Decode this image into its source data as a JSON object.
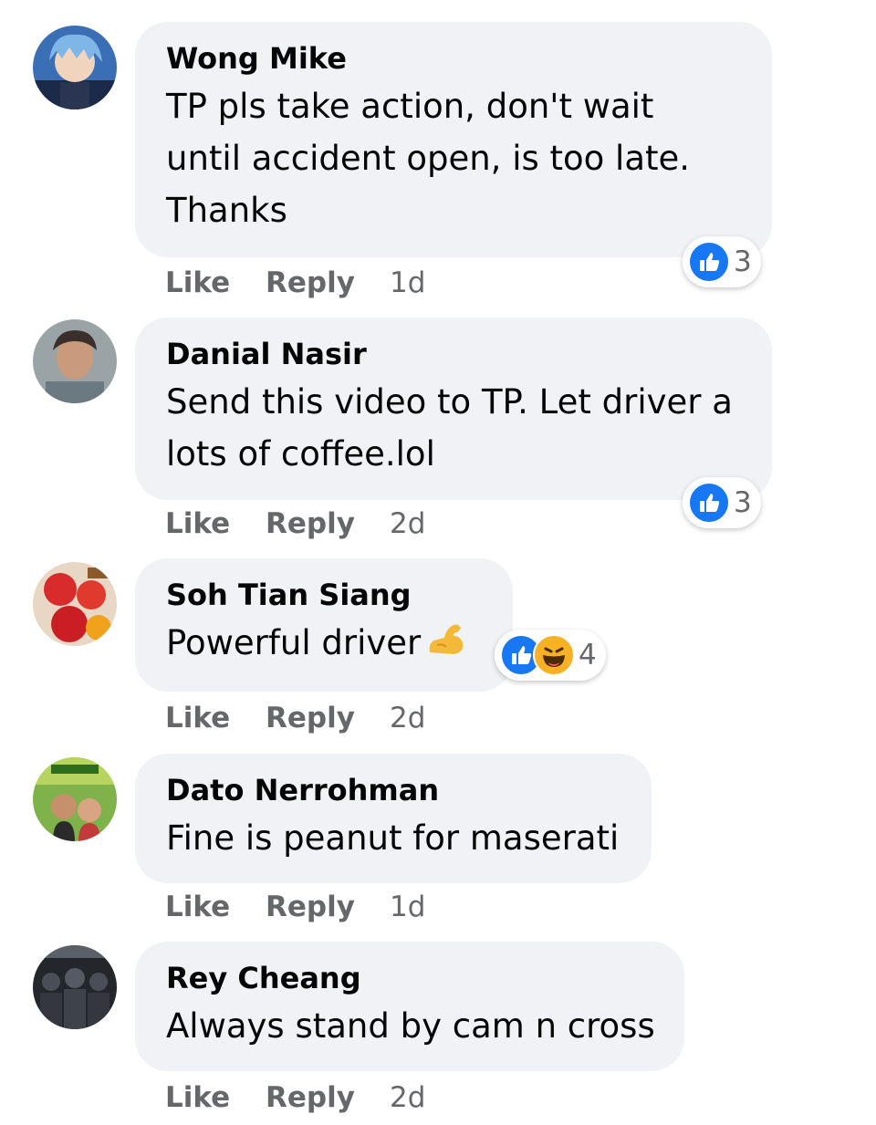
{
  "actions": {
    "like_label": "Like",
    "reply_label": "Reply"
  },
  "colors": {
    "bubble_bg": "#f0f2f5",
    "meta_text": "#65676b",
    "like_blue": "#1877f2",
    "haha_yellow": "#f7b125"
  },
  "comments": [
    {
      "author": "Wong Mike",
      "text_lines": [
        "TP pls take action, don't wait",
        "until accident open, is too late.",
        "Thanks"
      ],
      "time": "1d",
      "reactions": [
        "like-icon"
      ],
      "reaction_count": "3"
    },
    {
      "author": "Danial Nasir",
      "text_lines": [
        "Send this video to TP. Let driver a",
        "lots of coffee.lol"
      ],
      "time": "2d",
      "reactions": [
        "like-icon"
      ],
      "reaction_count": "3"
    },
    {
      "author": "Soh Tian Siang",
      "text_lines": [
        "Powerful driver"
      ],
      "emoji": "flexed-biceps-icon",
      "time": "2d",
      "reactions": [
        "like-icon",
        "haha-icon"
      ],
      "reaction_count": "4"
    },
    {
      "author": "Dato Nerrohman",
      "text_lines": [
        "Fine is peanut for maserati"
      ],
      "time": "1d"
    },
    {
      "author": "Rey Cheang",
      "text_lines": [
        "Always stand by cam n cross"
      ],
      "time": "2d"
    }
  ]
}
